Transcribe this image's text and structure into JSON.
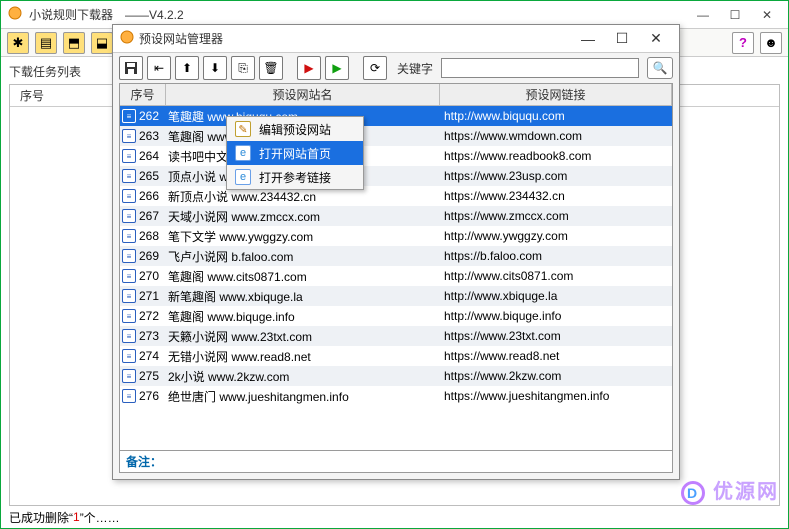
{
  "main": {
    "title": "小说规则下载器　——V4.2.2",
    "tasks_label": "下载任务列表",
    "tasks_header": "序号",
    "status_prefix": "已成功删除“",
    "status_count": "1",
    "status_suffix": "”个……",
    "watermark_text": "优源网",
    "watermark_badge": "D"
  },
  "modal": {
    "title": "预设网站管理器",
    "keyword_label": "关键字",
    "keyword_value": "",
    "columns": {
      "idx": "序号",
      "name": "预设网站名",
      "link": "预设网链接"
    },
    "remark_label": "备注：",
    "rows": [
      {
        "idx": "262",
        "name": "笔趣趣 www.biququ.com",
        "link": "http://www.biququ.com",
        "selected": true
      },
      {
        "idx": "263",
        "name": "笔趣阁 www.wmdown.com",
        "link": "https://www.wmdown.com"
      },
      {
        "idx": "264",
        "name": "读书吧中文网",
        "link": "https://www.readbook8.com"
      },
      {
        "idx": "265",
        "name": "顶点小说 www.23usp.com",
        "link": "https://www.23usp.com"
      },
      {
        "idx": "266",
        "name": "新顶点小说 www.234432.cn",
        "link": "https://www.234432.cn"
      },
      {
        "idx": "267",
        "name": "天域小说网 www.zmccx.com",
        "link": "https://www.zmccx.com"
      },
      {
        "idx": "268",
        "name": "笔下文学 www.ywggzy.com",
        "link": "http://www.ywggzy.com"
      },
      {
        "idx": "269",
        "name": "飞卢小说网 b.faloo.com",
        "link": "https://b.faloo.com"
      },
      {
        "idx": "270",
        "name": "笔趣阁 www.cits0871.com",
        "link": "http://www.cits0871.com"
      },
      {
        "idx": "271",
        "name": "新笔趣阁 www.xbiquge.la",
        "link": "http://www.xbiquge.la"
      },
      {
        "idx": "272",
        "name": "笔趣阁 www.biquge.info",
        "link": "http://www.biquge.info"
      },
      {
        "idx": "273",
        "name": "天籁小说网 www.23txt.com",
        "link": "https://www.23txt.com"
      },
      {
        "idx": "274",
        "name": "无错小说网 www.read8.net",
        "link": "https://www.read8.net"
      },
      {
        "idx": "275",
        "name": "2k小说 www.2kzw.com",
        "link": "https://www.2kzw.com"
      },
      {
        "idx": "276",
        "name": "绝世唐门 www.jueshitangmen.info",
        "link": "https://www.jueshitangmen.info"
      }
    ]
  },
  "context_menu": {
    "items": [
      {
        "label": "编辑预设网站",
        "selected": false
      },
      {
        "label": "打开网站首页",
        "selected": true
      },
      {
        "label": "打开参考链接",
        "selected": false
      }
    ]
  }
}
